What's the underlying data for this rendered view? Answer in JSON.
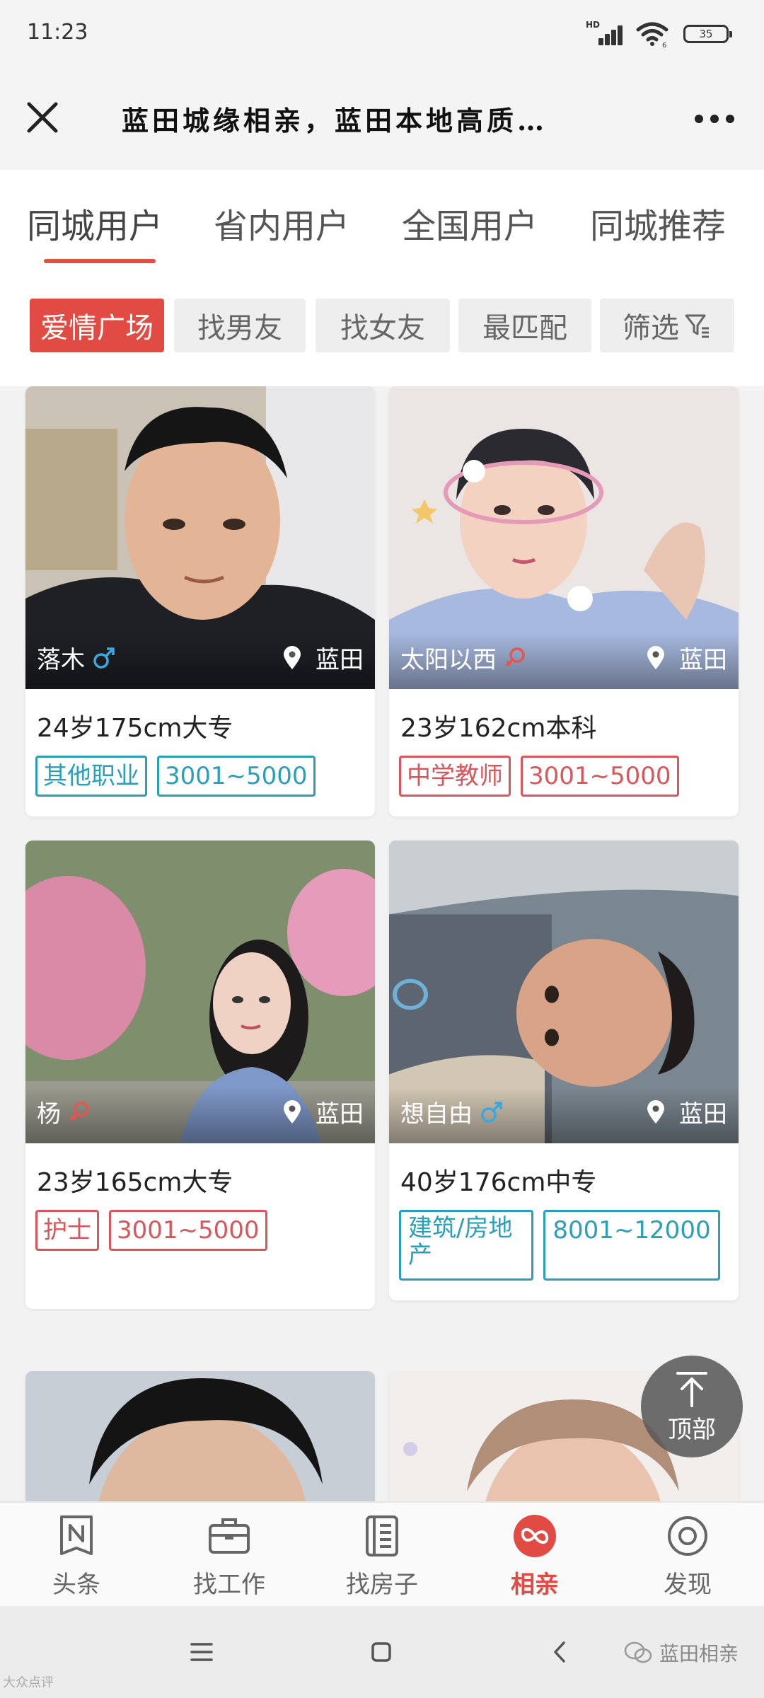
{
  "status_bar": {
    "time": "11:23",
    "network": "HD",
    "wifi_badge": "6",
    "battery": "35"
  },
  "title_bar": {
    "title": "蓝田城缘相亲，蓝田本地高质…"
  },
  "tabs": [
    {
      "label": "同城用户",
      "active": true
    },
    {
      "label": "省内用户",
      "active": false
    },
    {
      "label": "全国用户",
      "active": false
    },
    {
      "label": "同城推荐",
      "active": false
    }
  ],
  "filters": [
    {
      "label": "爱情广场",
      "active": true
    },
    {
      "label": "找男友",
      "active": false
    },
    {
      "label": "找女友",
      "active": false
    },
    {
      "label": "最匹配",
      "active": false
    },
    {
      "label": "筛选",
      "active": false,
      "icon": "filter-icon"
    }
  ],
  "cards": [
    {
      "nickname": "落木",
      "gender": "male",
      "location": "蓝田",
      "info": "24岁175cm大专",
      "tags": [
        "其他职业",
        "3001~5000"
      ],
      "tag_color": "teal"
    },
    {
      "nickname": "太阳以西",
      "gender": "female",
      "location": "蓝田",
      "info": "23岁162cm本科",
      "tags": [
        "中学教师",
        "3001~5000"
      ],
      "tag_color": "red"
    },
    {
      "nickname": "杨",
      "gender": "female",
      "location": "蓝田",
      "info": "23岁165cm大专",
      "tags": [
        "护士",
        "3001~5000"
      ],
      "tag_color": "red"
    },
    {
      "nickname": "想自由",
      "gender": "male",
      "location": "蓝田",
      "info": "40岁176cm中专",
      "tags": [
        "建筑/房地产",
        "8001~12000"
      ],
      "tag_color": "teal"
    }
  ],
  "back_to_top": {
    "label": "顶部"
  },
  "bottom_nav": [
    {
      "label": "头条",
      "icon": "news-icon",
      "active": false
    },
    {
      "label": "找工作",
      "icon": "briefcase-icon",
      "active": false
    },
    {
      "label": "找房子",
      "icon": "building-icon",
      "active": false
    },
    {
      "label": "相亲",
      "icon": "dating-icon",
      "active": true
    },
    {
      "label": "发现",
      "icon": "discover-icon",
      "active": false
    }
  ],
  "watermark": {
    "text": "蓝田相亲"
  },
  "corner_mark": {
    "text": "大众点评"
  },
  "colors": {
    "accent": "#e24b43",
    "teal_tag": "#2aa0b8",
    "red_tag": "#d9565c",
    "male_icon": "#3aa8e0",
    "female_icon": "#e0584f"
  }
}
